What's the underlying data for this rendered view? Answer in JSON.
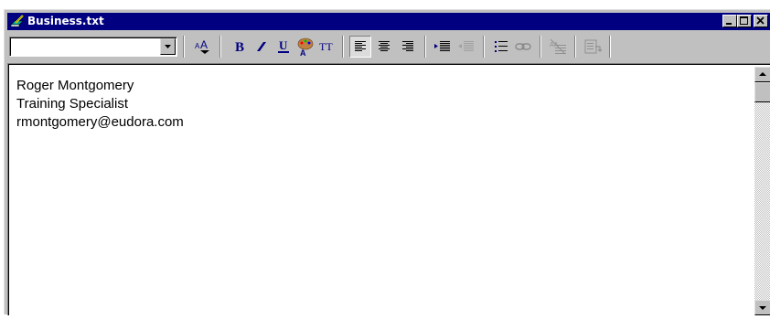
{
  "window": {
    "title": "Business.txt",
    "title_bar_color": "#000080",
    "controls": [
      "minimize-icon",
      "maximize-icon",
      "close-icon"
    ]
  },
  "toolbar": {
    "font_combo": {
      "value": ""
    },
    "buttons": [
      {
        "name": "text-size-icon",
        "label": "AA"
      },
      {
        "name": "bold-icon",
        "label": "B"
      },
      {
        "name": "italic-icon",
        "label": ""
      },
      {
        "name": "underline-icon",
        "label": "U"
      },
      {
        "name": "text-color-icon",
        "label": ""
      },
      {
        "name": "teletype-icon",
        "label": "TT"
      },
      {
        "name": "align-left-icon",
        "label": "",
        "pressed": true
      },
      {
        "name": "align-center-icon",
        "label": ""
      },
      {
        "name": "align-right-icon",
        "label": ""
      },
      {
        "name": "increase-indent-icon",
        "label": ""
      },
      {
        "name": "decrease-indent-icon",
        "label": ""
      },
      {
        "name": "bullet-list-icon",
        "label": ""
      },
      {
        "name": "link-icon",
        "label": ""
      },
      {
        "name": "clear-formatting-icon",
        "label": ""
      },
      {
        "name": "insert-object-icon",
        "label": ""
      }
    ]
  },
  "editor": {
    "lines": [
      "Roger Montgomery",
      "Training Specialist",
      "rmontgomery@eudora.com"
    ]
  }
}
